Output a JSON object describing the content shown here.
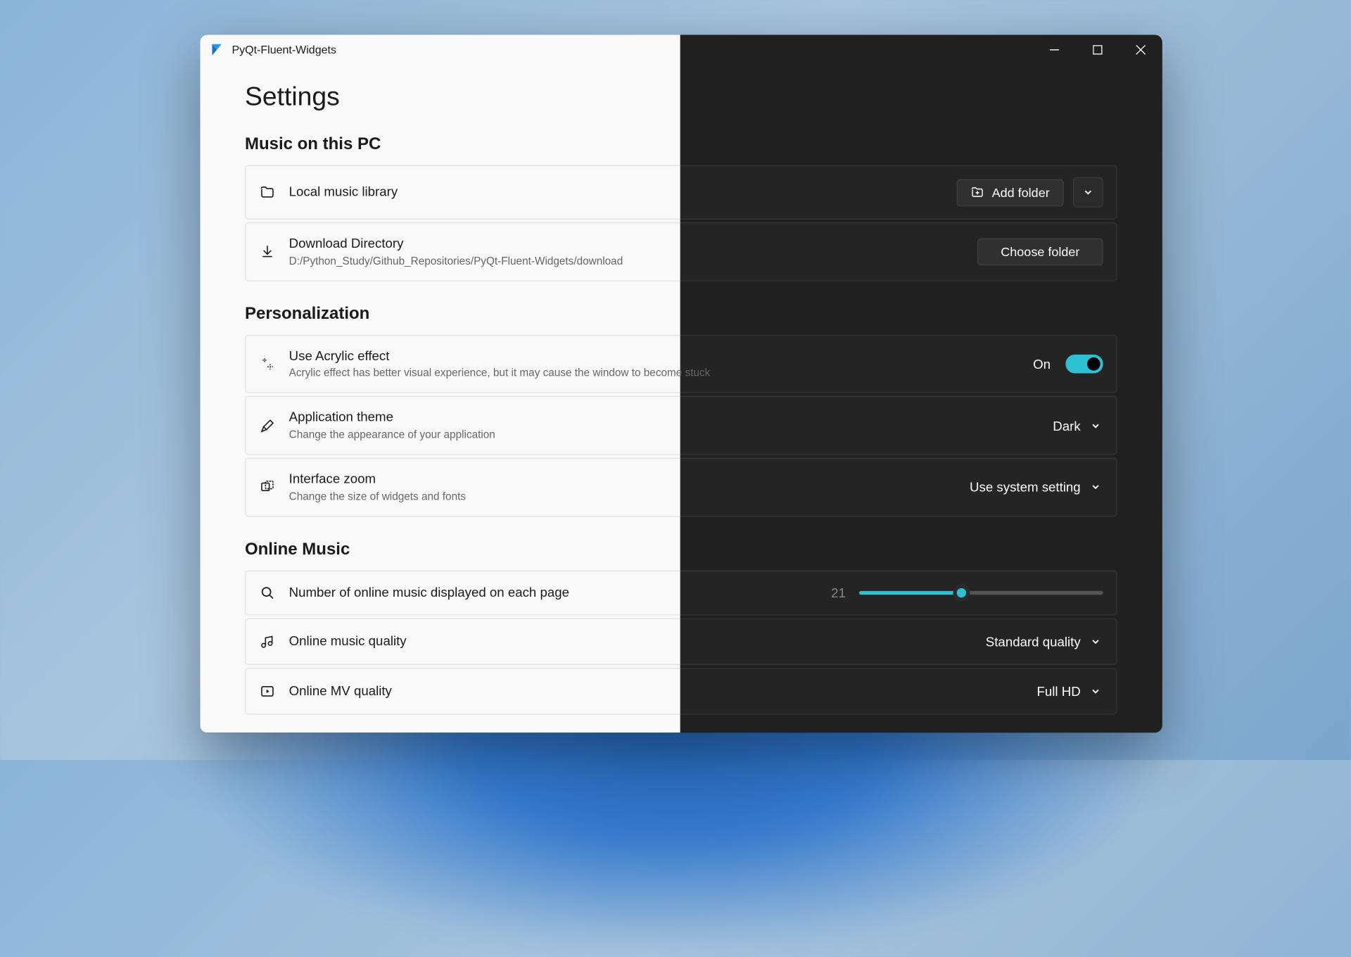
{
  "window_title": "PyQt-Fluent-Widgets",
  "page_title": "Settings",
  "sections": {
    "music_pc": {
      "header": "Music on this PC",
      "local_library": {
        "title": "Local music library",
        "add_btn": "Add folder"
      },
      "download_dir": {
        "title": "Download Directory",
        "path": "D:/Python_Study/Github_Repositories/PyQt-Fluent-Widgets/download",
        "choose_btn": "Choose folder"
      }
    },
    "personalization": {
      "header": "Personalization",
      "acrylic": {
        "title": "Use Acrylic effect",
        "sub": "Acrylic effect has better visual experience, but it may cause the window to become stuck",
        "state_label": "On",
        "state": true
      },
      "theme": {
        "title": "Application theme",
        "sub": "Change the appearance of your application",
        "value": "Dark"
      },
      "zoom": {
        "title": "Interface zoom",
        "sub": "Change the size of widgets and fonts",
        "value": "Use system setting"
      }
    },
    "online_music": {
      "header": "Online Music",
      "page_count": {
        "title": "Number of online music displayed on each page",
        "value": 21,
        "min": 0,
        "max": 50
      },
      "music_quality": {
        "title": "Online music quality",
        "value": "Standard quality"
      },
      "mv_quality": {
        "title": "Online MV quality",
        "value": "Full HD"
      }
    }
  },
  "colors": {
    "accent": "#2cc0d3"
  }
}
